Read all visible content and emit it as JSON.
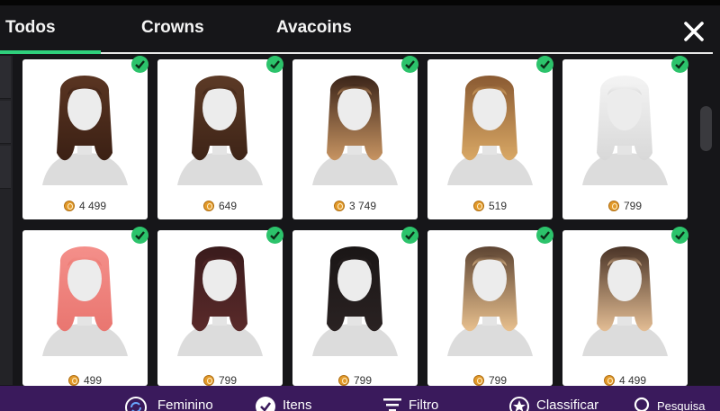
{
  "tabs": [
    {
      "label": "Todos",
      "active": true
    },
    {
      "label": "Crowns",
      "active": false
    },
    {
      "label": "Avacoins",
      "active": false
    }
  ],
  "close_icon": "close-icon",
  "accent_color": "#2fd07c",
  "bottom_bar_color": "#3a1a5c",
  "items": [
    {
      "price": "4 499",
      "owned": true,
      "hair": "brown-braided-pigtails"
    },
    {
      "price": "649",
      "owned": true,
      "hair": "brown-double-buns"
    },
    {
      "price": "3 749",
      "owned": true,
      "hair": "ombre-long-waves"
    },
    {
      "price": "519",
      "owned": true,
      "hair": "honey-wavy-bangs"
    },
    {
      "price": "799",
      "owned": true,
      "hair": "white-long-straight"
    },
    {
      "price": "499",
      "owned": true,
      "hair": "pink-short-bob"
    },
    {
      "price": "799",
      "owned": true,
      "hair": "dark-red-long-bangs"
    },
    {
      "price": "799",
      "owned": true,
      "hair": "black-bangs-cat-ears"
    },
    {
      "price": "799",
      "owned": true,
      "hair": "blonde-ombre-waves"
    },
    {
      "price": "4 499",
      "owned": true,
      "hair": "brown-blonde-straight"
    }
  ],
  "bottom_bar": {
    "gender_label": "Feminino",
    "items_label": "Itens",
    "filter_label": "Filtro",
    "sort_label": "Classificar",
    "search_label": "Pesquisa"
  }
}
